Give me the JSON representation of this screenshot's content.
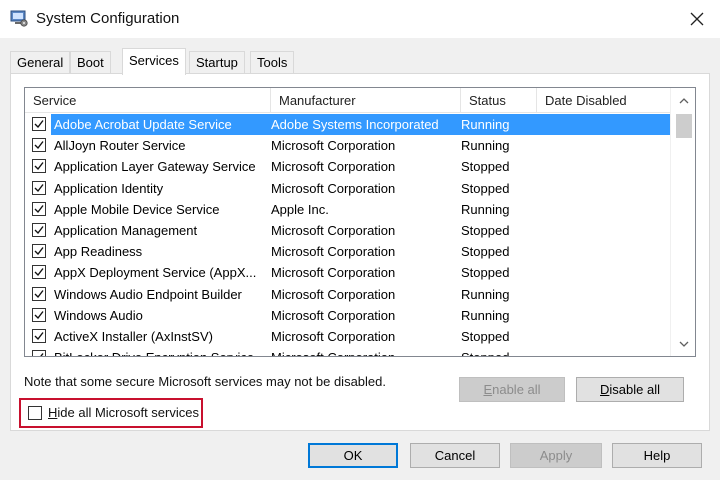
{
  "window": {
    "title": "System Configuration"
  },
  "tabs": [
    "General",
    "Boot",
    "Services",
    "Startup",
    "Tools"
  ],
  "active_tab": "Services",
  "columns": {
    "service": "Service",
    "manufacturer": "Manufacturer",
    "status": "Status",
    "date_disabled": "Date Disabled"
  },
  "services": [
    {
      "name": "Adobe Acrobat Update Service",
      "manufacturer": "Adobe Systems Incorporated",
      "status": "Running",
      "checked": true,
      "selected": true
    },
    {
      "name": "AllJoyn Router Service",
      "manufacturer": "Microsoft Corporation",
      "status": "Running",
      "checked": true
    },
    {
      "name": "Application Layer Gateway Service",
      "manufacturer": "Microsoft Corporation",
      "status": "Stopped",
      "checked": true
    },
    {
      "name": "Application Identity",
      "manufacturer": "Microsoft Corporation",
      "status": "Stopped",
      "checked": true
    },
    {
      "name": "Apple Mobile Device Service",
      "manufacturer": "Apple Inc.",
      "status": "Running",
      "checked": true
    },
    {
      "name": "Application Management",
      "manufacturer": "Microsoft Corporation",
      "status": "Stopped",
      "checked": true
    },
    {
      "name": "App Readiness",
      "manufacturer": "Microsoft Corporation",
      "status": "Stopped",
      "checked": true
    },
    {
      "name": "AppX Deployment Service (AppX...",
      "manufacturer": "Microsoft Corporation",
      "status": "Stopped",
      "checked": true
    },
    {
      "name": "Windows Audio Endpoint Builder",
      "manufacturer": "Microsoft Corporation",
      "status": "Running",
      "checked": true
    },
    {
      "name": "Windows Audio",
      "manufacturer": "Microsoft Corporation",
      "status": "Running",
      "checked": true
    },
    {
      "name": "ActiveX Installer (AxInstSV)",
      "manufacturer": "Microsoft Corporation",
      "status": "Stopped",
      "checked": true
    },
    {
      "name": "BitLocker Drive Encryption Service",
      "manufacturer": "Microsoft Corporation",
      "status": "Stopped",
      "checked": true
    }
  ],
  "note": "Note that some secure Microsoft services may not be disabled.",
  "enable_all": {
    "accel": "E",
    "rest": "nable all",
    "disabled": true
  },
  "disable_all": {
    "accel": "D",
    "rest": "isable all"
  },
  "hide_ms": {
    "accel": "H",
    "rest": "ide all Microsoft services",
    "checked": false
  },
  "buttons": {
    "ok": "OK",
    "cancel": "Cancel",
    "apply": "Apply",
    "help": "Help"
  },
  "colors": {
    "selection": "#3399ff",
    "highlight_box": "#c8102e",
    "default_button_border": "#0078d7"
  },
  "icons": {
    "app": "system-config-icon",
    "close": "close-icon",
    "check": "checkmark-icon",
    "scroll_up": "chevron-up-icon",
    "scroll_down": "chevron-down-icon"
  }
}
